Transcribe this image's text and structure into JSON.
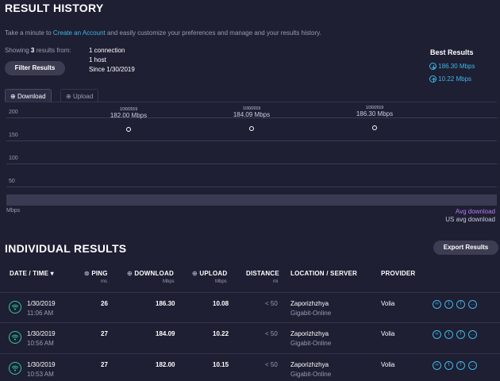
{
  "header": {
    "title": "RESULT HISTORY",
    "intro_before": "Take a minute to ",
    "intro_link": "Create an Account",
    "intro_after": " and easily customize your preferences and manage and your results history."
  },
  "summary": {
    "showing_prefix": "Showing ",
    "showing_count": "3",
    "showing_suffix": " results from:",
    "connections": "1 connection",
    "hosts": "1 host",
    "since": "Since 1/30/2019",
    "filter_label": "Filter Results"
  },
  "best": {
    "title": "Best Results",
    "download": "186.30 Mbps",
    "upload": "10.22 Mbps"
  },
  "tabs": {
    "download": "Download",
    "upload": "Upload"
  },
  "chart_data": {
    "type": "line",
    "ylabel": "Mbps",
    "ylim": [
      0,
      200
    ],
    "yticks": [
      "200",
      "150",
      "100",
      "50"
    ],
    "points": [
      {
        "date": "1/30/2019",
        "value": 182.0,
        "label": "182.00 Mbps"
      },
      {
        "date": "1/30/2019",
        "value": 184.09,
        "label": "184.09 Mbps"
      },
      {
        "date": "1/30/2019",
        "value": 186.3,
        "label": "186.30 Mbps"
      }
    ],
    "legend": {
      "avg": "Avg download",
      "us_avg": "US avg download"
    },
    "colors": {
      "avg": "#b57cf2",
      "us_avg": "#c9cbe0"
    }
  },
  "individual": {
    "title": "INDIVIDUAL RESULTS",
    "export_label": "Export Results",
    "headers": {
      "date": "DATE / TIME",
      "ping": "PING",
      "download": "DOWNLOAD",
      "upload": "UPLOAD",
      "distance": "DISTANCE",
      "location": "LOCATION / SERVER",
      "provider": "PROVIDER"
    },
    "units": {
      "ping": "ms",
      "download": "Mbps",
      "upload": "Mbps",
      "distance": "mi"
    },
    "rows": [
      {
        "date": "1/30/2019",
        "time": "11:06 AM",
        "ping": "26",
        "download": "186.30",
        "upload": "10.08",
        "distance": "< 50",
        "location": "Zaporizhzhya",
        "server": "Gigabit-Online",
        "provider": "Volia"
      },
      {
        "date": "1/30/2019",
        "time": "10:56 AM",
        "ping": "27",
        "download": "184.09",
        "upload": "10.22",
        "distance": "< 50",
        "location": "Zaporizhzhya",
        "server": "Gigabit-Online",
        "provider": "Volia"
      },
      {
        "date": "1/30/2019",
        "time": "10:53 AM",
        "ping": "27",
        "download": "182.00",
        "upload": "10.15",
        "distance": "< 50",
        "location": "Zaporizhzhya",
        "server": "Gigabit-Online",
        "provider": "Volia"
      }
    ]
  },
  "colors": {
    "background": "#1e1f33",
    "accent": "#3fb6e6",
    "wifi": "#2ec99a"
  }
}
